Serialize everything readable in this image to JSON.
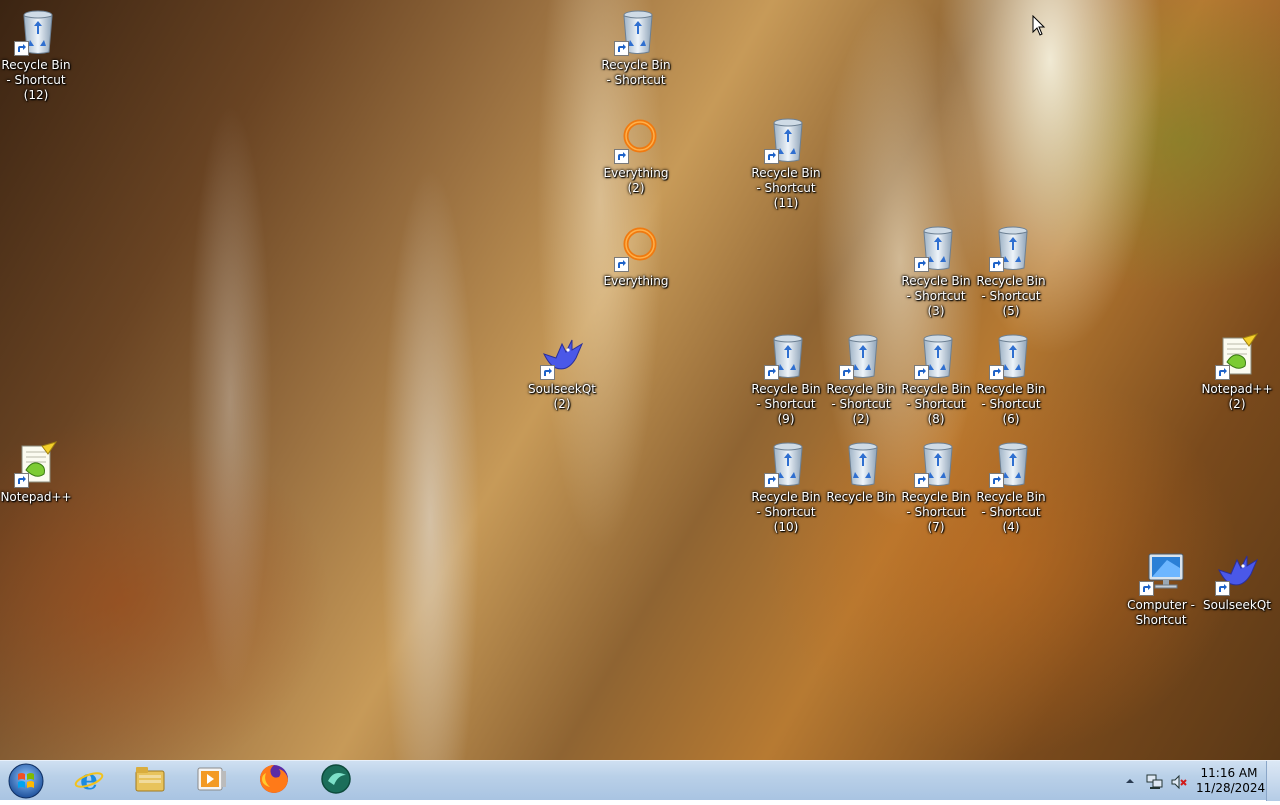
{
  "desktop": {
    "icons": [
      {
        "label": "Recycle Bin - Shortcut (12)",
        "icon": "recycle-bin-icon"
      },
      {
        "label": "Recycle Bin - Shortcut",
        "icon": "recycle-bin-icon"
      },
      {
        "label": "Everything (2)",
        "icon": "everything-icon"
      },
      {
        "label": "Everything",
        "icon": "everything-icon"
      },
      {
        "label": "Recycle Bin - Shortcut (11)",
        "icon": "recycle-bin-icon"
      },
      {
        "label": "Recycle Bin - Shortcut (3)",
        "icon": "recycle-bin-icon"
      },
      {
        "label": "Recycle Bin - Shortcut (5)",
        "icon": "recycle-bin-icon"
      },
      {
        "label": "SoulseekQt (2)",
        "icon": "soulseek-icon"
      },
      {
        "label": "Recycle Bin - Shortcut (9)",
        "icon": "recycle-bin-icon"
      },
      {
        "label": "Recycle Bin - Shortcut (2)",
        "icon": "recycle-bin-icon"
      },
      {
        "label": "Recycle Bin - Shortcut (8)",
        "icon": "recycle-bin-icon"
      },
      {
        "label": "Recycle Bin - Shortcut (6)",
        "icon": "recycle-bin-icon"
      },
      {
        "label": "Notepad++ (2)",
        "icon": "notepad-plus-plus-icon"
      },
      {
        "label": "Notepad++",
        "icon": "notepad-plus-plus-icon"
      },
      {
        "label": "Recycle Bin - Shortcut (10)",
        "icon": "recycle-bin-icon"
      },
      {
        "label": "Recycle Bin",
        "icon": "recycle-bin-icon"
      },
      {
        "label": "Recycle Bin - Shortcut (7)",
        "icon": "recycle-bin-icon"
      },
      {
        "label": "Recycle Bin - Shortcut (4)",
        "icon": "recycle-bin-icon"
      },
      {
        "label": "Computer - Shortcut",
        "icon": "computer-icon"
      },
      {
        "label": "SoulseekQt",
        "icon": "soulseek-icon"
      }
    ]
  },
  "taskbar": {
    "pinned": [
      {
        "icon": "internet-explorer-icon"
      },
      {
        "icon": "file-explorer-icon"
      },
      {
        "icon": "media-player-icon"
      },
      {
        "icon": "firefox-icon"
      },
      {
        "icon": "app-icon"
      }
    ],
    "tray": {
      "icons": [
        "show-hidden-icons-icon",
        "network-icon",
        "volume-muted-icon"
      ]
    },
    "clock": {
      "time": "11:16 AM",
      "date": "11/28/2024"
    }
  },
  "colors": {
    "taskbar": "#b9d0e8",
    "label_text": "#ffffff"
  }
}
